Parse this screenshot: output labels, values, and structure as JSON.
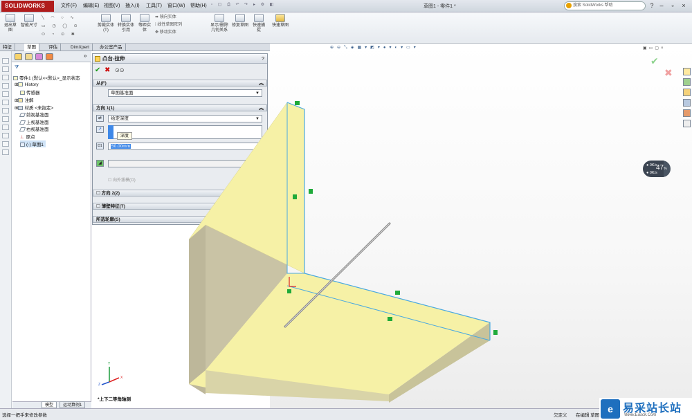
{
  "app": {
    "logo": "SOLIDWORKS",
    "document_title": "草图1 - 零件1 *",
    "search_placeholder": "搜索 SolidWorks 帮助"
  },
  "menu": [
    "文件(F)",
    "编辑(E)",
    "视图(V)",
    "插入(I)",
    "工具(T)",
    "窗口(W)",
    "帮助(H)"
  ],
  "ribbon": {
    "exit_sketch": "退出草图",
    "smart_dim": "智能尺寸",
    "trim": "剪裁实体(T)",
    "convert": "转换实体引用",
    "offset": "等距实体",
    "mirror": "镜向实体",
    "linear_pattern": "线性草图阵列",
    "move": "移动实体",
    "display_delete": "显示/删除几何关系",
    "repair": "修复草图",
    "quick_snaps": "快速捕捉",
    "rapid_sketch": "快速草图"
  },
  "tabs": [
    "特征",
    "草图",
    "评估",
    "DimXpert",
    "办公室产品"
  ],
  "tree": {
    "root": "零件1 (默认<<默认>_显示状态",
    "items": [
      "History",
      "传感器",
      "注解",
      "材质 <未指定>",
      "前视基准面",
      "上视基准面",
      "右视基准面",
      "原点",
      "(-) 草图1"
    ]
  },
  "property_manager": {
    "title": "凸台-拉伸",
    "help": "?",
    "from_header": "从(F)",
    "from_value": "草图基准面",
    "dir1_header": "方向 1(1)",
    "end_condition": "给定深度",
    "tooltip": "深度",
    "depth_value": "50.00mm",
    "draft_outward": "向外拔模(O)",
    "dir2_header": "方向 2(2)",
    "thin_header": "薄壁特征(T)",
    "contours_header": "所选轮廓(S)"
  },
  "view": {
    "orientation": "*上下二等角轴测"
  },
  "perf_widget": {
    "percent": "47",
    "percent_unit": "%",
    "up": "0K/s",
    "down": "0K/s"
  },
  "bottom_tabs": [
    "模型",
    "运动算例1"
  ],
  "status": {
    "hint": "选择一把手来修改参数",
    "defined": "欠定义",
    "editing": "在编辑 草图1"
  },
  "watermark": {
    "brand": "易采站长站",
    "url": "Www.Easck.Com"
  },
  "colors": {
    "part_face": "#f6f1a6",
    "part_side": "#bdb79a",
    "sketch_edge": "#4aa9e0",
    "brand": "#b01c1c"
  }
}
